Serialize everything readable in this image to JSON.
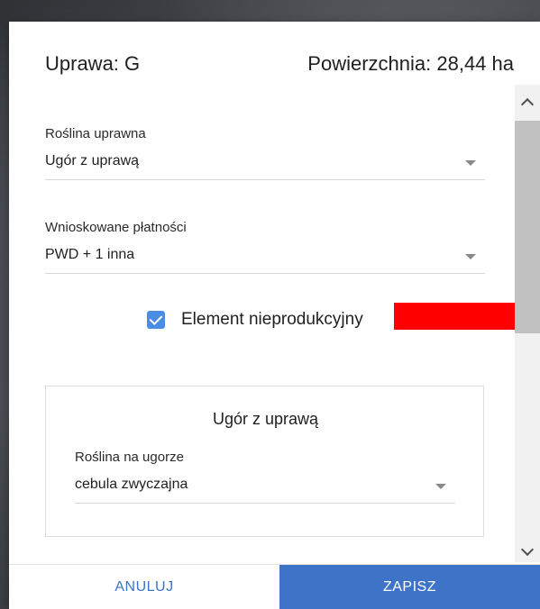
{
  "header": {
    "crop_label": "Uprawa: G",
    "area_label": "Powierzchnia: 28,44 ha"
  },
  "fields": {
    "crop_plant": {
      "label": "Roślina uprawna",
      "value": "Ugór z uprawą"
    },
    "requested_payments": {
      "label": "Wnioskowane płatności",
      "value": "PWD + 1 inna"
    }
  },
  "non_productive": {
    "label": "Element nieprodukcyjny",
    "checked": true
  },
  "fallow_panel": {
    "title": "Ugór z uprawą",
    "plant_on_fallow": {
      "label": "Roślina na ugorze",
      "value": "cebula zwyczajna"
    }
  },
  "footer": {
    "cancel_label": "ANULUJ",
    "save_label": "ZAPISZ"
  },
  "colors": {
    "accent": "#3f73c8",
    "checkbox": "#4a8de6",
    "highlight": "#ff0000"
  }
}
